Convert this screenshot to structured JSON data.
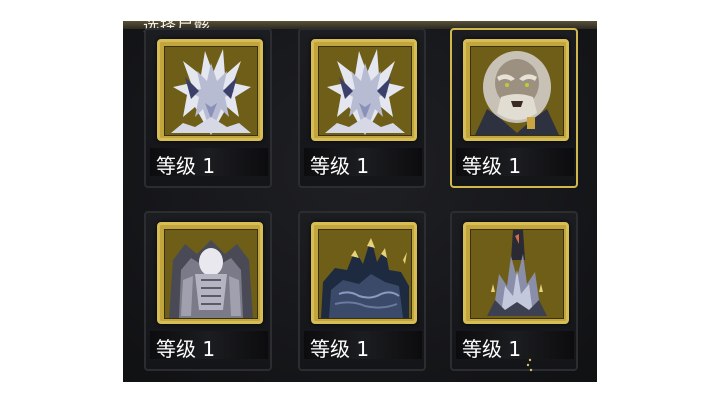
{
  "panel": {
    "title": "选择尸骸"
  },
  "characters": [
    {
      "level_label": "等级 1",
      "portrait": "white-flame-creature-icon",
      "selected": false
    },
    {
      "level_label": "等级 1",
      "portrait": "white-flame-creature-icon",
      "selected": false
    },
    {
      "level_label": "等级 1",
      "portrait": "old-bearded-man-icon",
      "selected": true
    },
    {
      "level_label": "等级 1",
      "portrait": "armored-skull-beast-icon",
      "selected": false
    },
    {
      "level_label": "等级 1",
      "portrait": "spiked-dark-beast-icon",
      "selected": false
    },
    {
      "level_label": "等级 1",
      "portrait": "crystal-spire-creature-icon",
      "selected": false
    }
  ],
  "colors": {
    "frame_gold": "#d6bd55",
    "portrait_bg": "#6e5e18",
    "selection_border": "#d2b84c",
    "background": "#16171a"
  }
}
